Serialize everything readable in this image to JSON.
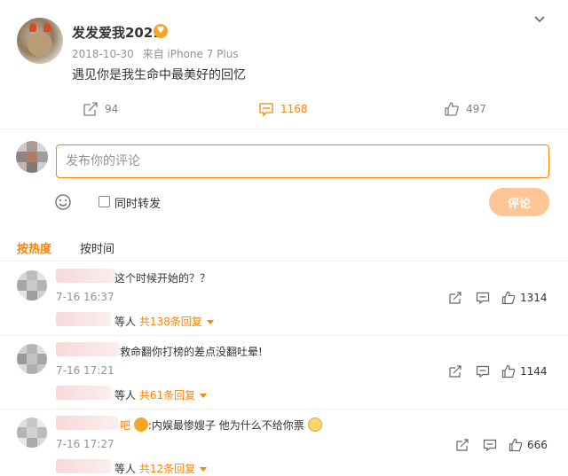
{
  "post": {
    "username": "发发爱我2021",
    "date": "2018-10-30",
    "source": "来自 iPhone 7 Plus",
    "text": "遇见你是我生命中最美好的回忆",
    "reposts": "94",
    "comments": "1168",
    "likes": "497"
  },
  "composer": {
    "placeholder": "发布你的评论",
    "forward_label": "同时转发",
    "submit_label": "评论"
  },
  "sort": {
    "hot": "按热度",
    "time": "按时间"
  },
  "comments": [
    {
      "text": "这个时候开始的？？",
      "time": "7-16 16:37",
      "likes": "1314",
      "reply_prefix": "等人",
      "reply_count": "共138条回复"
    },
    {
      "text": "救命翻你打榜的差点没翻吐晕!",
      "time": "7-16 17:21",
      "likes": "1144",
      "reply_prefix": "等人",
      "reply_count": "共61条回复"
    },
    {
      "text_prefix": "吧",
      "text": ":内娱最惨嫂子 他为什么不给你票",
      "time": "7-16 17:27",
      "likes": "666",
      "reply_prefix": "等人",
      "reply_count": "共12条回复"
    }
  ],
  "colors": {
    "accent": "#ff8200",
    "submit_disabled": "#ffc594",
    "muted": "#939393"
  }
}
